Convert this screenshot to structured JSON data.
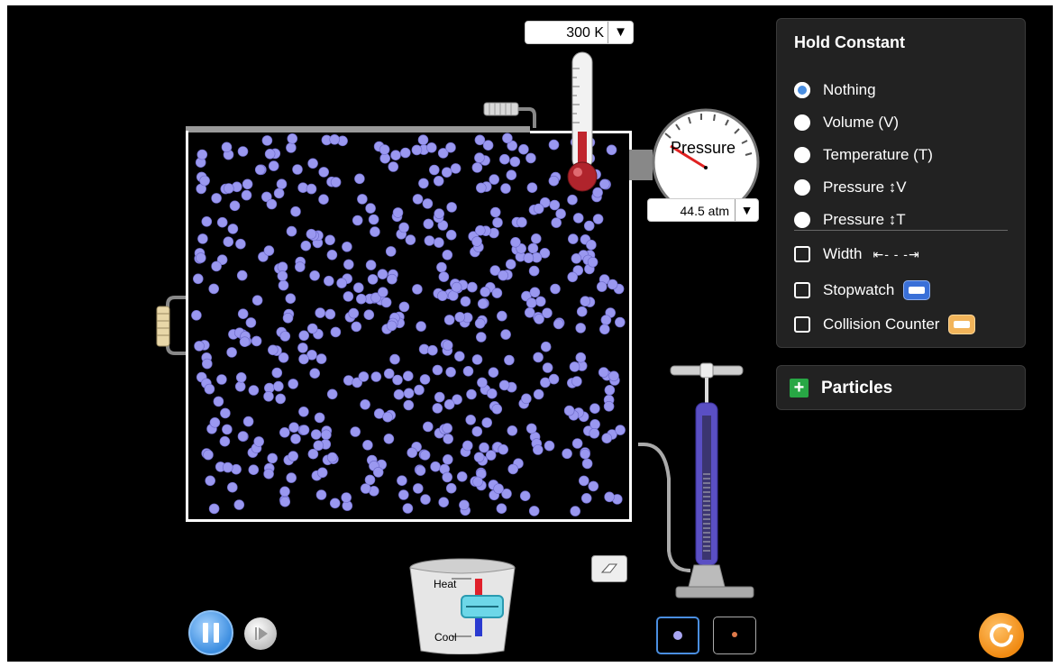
{
  "simulation": {
    "temperature": {
      "value": "300 K",
      "dropdown_glyph": "▼"
    },
    "pressure_gauge": {
      "label": "Pressure",
      "value": "44.5 atm",
      "dropdown_glyph": "▼"
    },
    "bucket": {
      "heat_label": "Heat",
      "cool_label": "Cool"
    }
  },
  "panel": {
    "title": "Hold Constant",
    "options": [
      {
        "label": "Nothing",
        "selected": true
      },
      {
        "label": "Volume (V)",
        "selected": false
      },
      {
        "label": "Temperature (T)",
        "selected": false
      },
      {
        "label": "Pressure ↕V",
        "selected": false
      },
      {
        "label": "Pressure ↕T",
        "selected": false
      }
    ],
    "checks": [
      {
        "label": "Width",
        "icon": "width-arrows-icon",
        "glyph": "⇤- - -⇥",
        "checked": false
      },
      {
        "label": "Stopwatch",
        "icon": "stopwatch-icon",
        "checked": false
      },
      {
        "label": "Collision Counter",
        "icon": "collision-counter-icon",
        "checked": false
      }
    ]
  },
  "particles_panel": {
    "label": "Particles",
    "expand_glyph": "+"
  },
  "colors": {
    "particle": "#9a98f0",
    "accent_blue": "#4a8ee0",
    "reset_orange": "#f08a12",
    "plus_green": "#28a745"
  }
}
